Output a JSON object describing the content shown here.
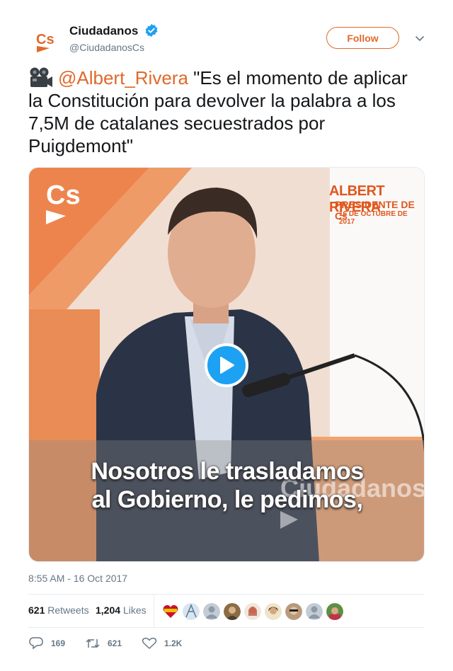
{
  "account": {
    "name": "Ciudadanos",
    "handle": "@CiudadanosCs",
    "follow_label": "Follow",
    "brand_color": "#e0692b",
    "avatar_text": "Cs"
  },
  "tweet": {
    "emoji": "movie-camera-icon",
    "mention": "@Albert_Rivera",
    "text": " \"Es el momento de aplicar la Constitución para devolver la palabra a los 7,5M de catalanes secuestrados por Puigdemont\""
  },
  "media": {
    "logo": "Cs",
    "overlay_name": "ALBERT RIVERA",
    "overlay_role": "PRESIDENTE DE Cs",
    "overlay_date": "16 DE OCTUBRE DE 2017",
    "subtitle_line1": "Nosotros le trasladamos",
    "subtitle_line2": "al Gobierno, le pedimos,",
    "backdrop_text": "Ciudadanos",
    "play_color": "#1da1f2"
  },
  "timestamp": "8:55 AM - 16 Oct 2017",
  "stats": {
    "retweets_count": "621",
    "retweets_label": "Retweets",
    "likes_count": "1,204",
    "likes_label": "Likes"
  },
  "actions": {
    "replies": "169",
    "retweets": "621",
    "likes": "1.2K"
  }
}
